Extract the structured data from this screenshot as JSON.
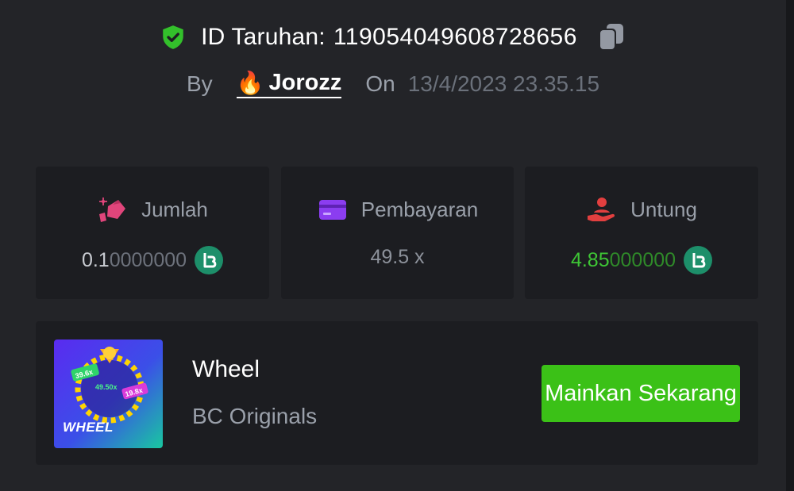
{
  "bet": {
    "id_label": "ID Taruhan:",
    "id": "119054049608728656",
    "by_label": "By",
    "username": "Jorozz",
    "on_label": "On",
    "date": "13/4/2023 23.35.15"
  },
  "stats": [
    {
      "label": "Jumlah",
      "value_main": "0.1",
      "value_dim": "0000000",
      "icon": "money-bag-icon",
      "currency_icon": "bc-coin-icon"
    },
    {
      "label": "Pembayaran",
      "value": "49.5 x",
      "icon": "card-icon"
    },
    {
      "label": "Untung",
      "value_main": "4.85",
      "value_dim": "000000",
      "icon": "profit-hand-icon",
      "currency_icon": "bc-coin-icon"
    }
  ],
  "game": {
    "title": "Wheel",
    "provider": "BC Originals",
    "thumbnail_text": "WHEEL",
    "thumb_multipliers": [
      "39.6x",
      "49.50x",
      "19.8x"
    ],
    "play_label": "Mainkan Sekarang"
  },
  "colors": {
    "background": "#232428",
    "card": "#1c1d21",
    "accent_green": "#3bc117",
    "profit_green": "#3ec635"
  }
}
